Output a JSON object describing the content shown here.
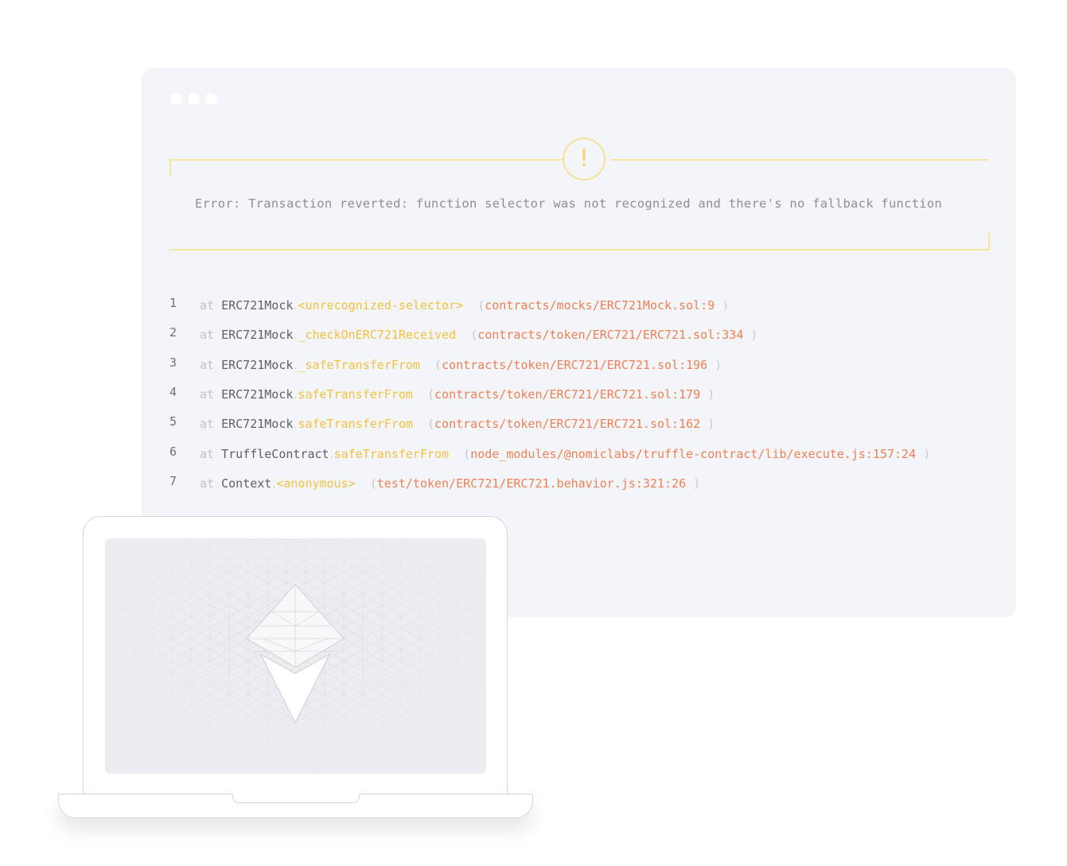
{
  "error": {
    "icon": "warning-exclamation-icon",
    "icon_glyph": "!",
    "message": "Error: Transaction reverted: function selector was not recognized and there's no fallback function"
  },
  "stack_trace": [
    {
      "num": "1",
      "at": "at",
      "cls": "ERC721Mock",
      "method": "<unrecognized-selector>",
      "file": "contracts/mocks/ERC721Mock.sol:9"
    },
    {
      "num": "2",
      "at": "at",
      "cls": "ERC721Mock",
      "method": "_checkOnERC721Received",
      "file": "contracts/token/ERC721/ERC721.sol:334"
    },
    {
      "num": "3",
      "at": "at",
      "cls": "ERC721Mock",
      "method": "_safeTransferFrom",
      "file": "contracts/token/ERC721/ERC721.sol:196"
    },
    {
      "num": "4",
      "at": "at",
      "cls": "ERC721Mock",
      "method": "safeTransferFrom",
      "file": "contracts/token/ERC721/ERC721.sol:179"
    },
    {
      "num": "5",
      "at": "at",
      "cls": "ERC721Mock",
      "method": "safeTransferFrom",
      "file": "contracts/token/ERC721/ERC721.sol:162"
    },
    {
      "num": "6",
      "at": "at",
      "cls": "TruffleContract",
      "method": "safeTransferFrom",
      "file": "node_modules/@nomiclabs/truffle-contract/lib/execute.js:157:24"
    },
    {
      "num": "7",
      "at": "at",
      "cls": "Context",
      "method": "<anonymous>",
      "file": "test/token/ERC721/ERC721.behavior.js:321:26"
    }
  ],
  "laptop": {
    "screen_icon": "ethereum-cube-logo-icon"
  },
  "colors": {
    "window_bg": "#f4f5f8",
    "error_border": "#f5e6a2",
    "method": "#f1c240",
    "file": "#ee8055",
    "class": "#5d6069"
  }
}
